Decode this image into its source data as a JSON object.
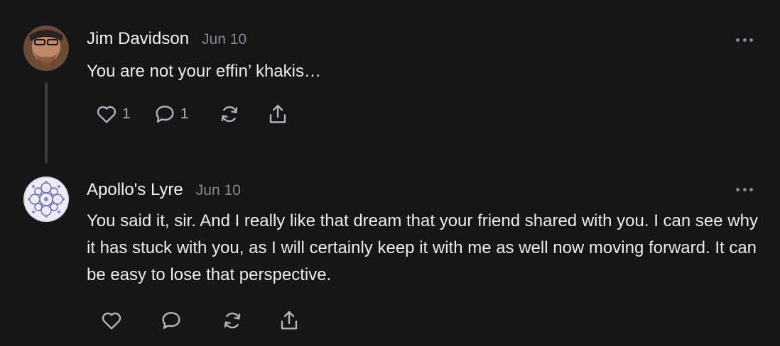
{
  "comments": [
    {
      "author": "Jim Davidson",
      "date": "Jun 10",
      "text": "You are not your effin’ khakis…",
      "likes": "1",
      "replies": "1"
    },
    {
      "author": "Apollo's Lyre",
      "date": "Jun 10",
      "text": "You said it, sir. And I really like that dream that your friend shared with you. I can see why it has stuck with you, as I will certainly keep it with me as well now moving forward. It can be easy to lose that perspective.",
      "likes": "",
      "replies": ""
    }
  ],
  "icons": {
    "like": "heart-icon",
    "reply": "comment-bubble-icon",
    "restack": "restack-icon",
    "share": "share-icon",
    "more": "more-dots-icon"
  },
  "colors": {
    "background": "#161618",
    "text": "#ececec",
    "muted": "#8a8a8e",
    "icon": "#b5b5b9"
  }
}
